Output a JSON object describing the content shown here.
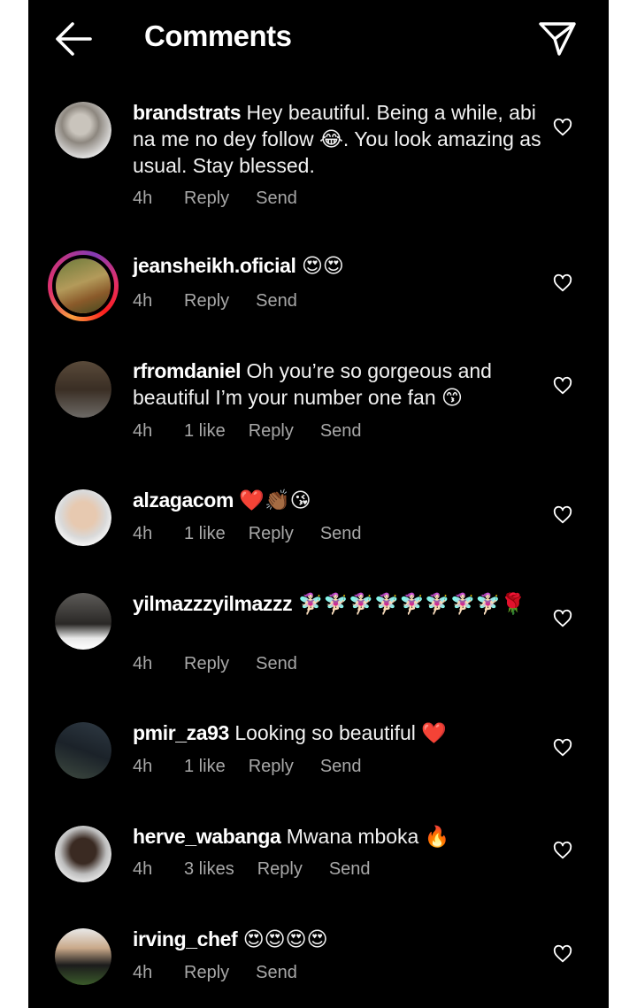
{
  "header": {
    "title": "Comments",
    "back_icon": "arrow-left-icon",
    "send_icon": "paper-plane-icon"
  },
  "labels": {
    "reply": "Reply",
    "send": "Send"
  },
  "colors": {
    "background": "#000000",
    "text": "#ffffff",
    "meta": "#a8a8a8"
  },
  "comments": [
    {
      "username": "brandstrats",
      "text": "Hey beautiful.  Being a while, abi na me no dey follow 😂. You look amazing as usual. Stay blessed.",
      "time": "4h",
      "likes": ""
    },
    {
      "username": "jeansheikh.oficial",
      "text": "😍😍",
      "time": "4h",
      "likes": ""
    },
    {
      "username": "rfromdaniel",
      "text": "Oh you’re so gorgeous and beautiful I’m your number one fan 😙",
      "time": "4h",
      "likes": "1 like"
    },
    {
      "username": "alzagacom",
      "text": "❤️👏🏾😘",
      "time": "4h",
      "likes": "1 like"
    },
    {
      "username": "yilmazzzyilmazzz",
      "text": "🧚🏻‍♀️🧚🏻‍♀️🧚🏻‍♀️🧚🏻‍♀️🧚🏻‍♀️🧚🏻‍♀️🧚🏻‍♀️🧚🏻‍♀️🌹",
      "time": "4h",
      "likes": ""
    },
    {
      "username": "pmir_za93",
      "text": "Looking so beautiful ❤️",
      "time": "4h",
      "likes": "1 like"
    },
    {
      "username": "herve_wabanga",
      "text": "Mwana mboka 🔥",
      "time": "4h",
      "likes": "3 likes"
    },
    {
      "username": "irving_chef",
      "text": "😍😍😍😍",
      "time": "4h",
      "likes": ""
    }
  ]
}
